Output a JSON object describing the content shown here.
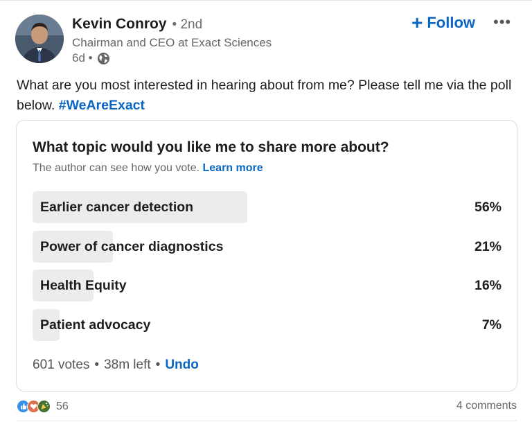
{
  "author": {
    "name": "Kevin Conroy",
    "degree": "• 2nd",
    "headline": "Chairman and CEO at Exact Sciences",
    "time": "6d •",
    "follow_label": "Follow",
    "more_label": "•••"
  },
  "post": {
    "text": "What are you most interested in hearing about from me? Please tell me via the poll below. ",
    "hashtag": "#WeAreExact"
  },
  "poll": {
    "question": "What topic would you like me to share more about?",
    "note": "The author can see how you vote.",
    "learn_more": "Learn more",
    "options": [
      {
        "label": "Earlier cancer detection",
        "percent_text": "56%",
        "percent": 56
      },
      {
        "label": "Power of cancer diagnostics",
        "percent_text": "21%",
        "percent": 21
      },
      {
        "label": "Health Equity",
        "percent_text": "16%",
        "percent": 16
      },
      {
        "label": "Patient advocacy",
        "percent_text": "7%",
        "percent": 7
      }
    ],
    "votes": "601 votes",
    "time_left": "38m left",
    "undo": "Undo"
  },
  "social": {
    "reaction_count": "56",
    "comments": "4 comments",
    "reaction_icons": [
      "like-icon",
      "love-icon",
      "celebrate-icon"
    ]
  },
  "colors": {
    "accent": "#0a66c2",
    "bar": "#ececec"
  }
}
